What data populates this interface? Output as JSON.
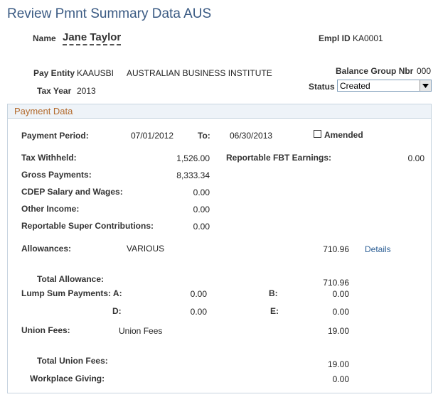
{
  "page": {
    "title": "Review Pmnt Summary Data AUS"
  },
  "header": {
    "name_label": "Name",
    "name_value": "Jane Taylor",
    "empl_label": "Empl ID",
    "empl_value": "KA0001",
    "pay_entity_label": "Pay Entity",
    "pay_entity_code": "KAAUSBI",
    "pay_entity_name": "AUSTRALIAN BUSINESS INSTITUTE",
    "balance_group_label": "Balance Group Nbr",
    "balance_group_value": "000",
    "tax_year_label": "Tax Year",
    "tax_year_value": "2013",
    "status_label": "Status",
    "status_value": "Created"
  },
  "payment": {
    "section_title": "Payment Data",
    "period_label": "Payment Period:",
    "period_from": "07/01/2012",
    "to_label": "To:",
    "period_to": "06/30/2013",
    "amended_label": "Amended",
    "amended_checked": false,
    "tax_withheld_label": "Tax Withheld:",
    "tax_withheld": "1,526.00",
    "fbt_label": "Reportable FBT Earnings:",
    "fbt_value": "0.00",
    "gross_label": "Gross Payments:",
    "gross_value": "8,333.34",
    "cdep_label": "CDEP Salary and Wages:",
    "cdep_value": "0.00",
    "other_label": "Other Income:",
    "other_value": "0.00",
    "super_label": "Reportable Super Contributions:",
    "super_value": "0.00",
    "allow_label": "Allowances:",
    "allow_type": "VARIOUS",
    "allow_value": "710.96",
    "details_link": "Details",
    "total_allow_label": "Total Allowance:",
    "total_allow_value": "710.96",
    "lump_label": "Lump Sum Payments: A:",
    "lump_a": "0.00",
    "b_label": "B:",
    "lump_b": "0.00",
    "d_label": "D:",
    "lump_d": "0.00",
    "e_label": "E:",
    "lump_e": "0.00",
    "union_label": "Union Fees:",
    "union_type": "Union Fees",
    "union_value": "19.00",
    "total_union_label": "Total Union Fees:",
    "total_union_value": "19.00",
    "workplace_label": "Workplace Giving:",
    "workplace_value": "0.00"
  }
}
